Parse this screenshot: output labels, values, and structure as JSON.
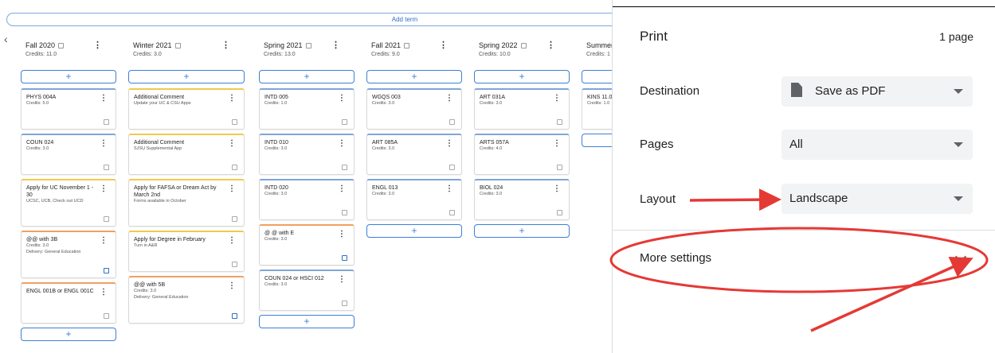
{
  "planner": {
    "add_term_label": "Add term",
    "add_label": "+",
    "terms": [
      {
        "name": "Fall 2020",
        "credits": "Credits: 11.0",
        "cards": [
          {
            "title": "PHYS 004A",
            "sub": [
              "Credits: 5.0"
            ],
            "accent": "blue",
            "note": "grey"
          },
          {
            "title": "COUN 024",
            "sub": [
              "Credits: 3.0"
            ],
            "accent": "blue",
            "note": "grey"
          },
          {
            "title": "Apply for UC November 1 - 30",
            "sub": [
              "UCSC, UCB, Check out UCD"
            ],
            "accent": "yellow",
            "note": "grey"
          },
          {
            "title": "@@ with 3B",
            "sub": [
              "Credits: 3.0",
              "Delivery: General Education"
            ],
            "accent": "orange",
            "note": "blue"
          },
          {
            "title": "ENGL 001B or ENGL 001C",
            "sub": [],
            "accent": "orange",
            "note": "grey"
          }
        ]
      },
      {
        "name": "Winter 2021",
        "credits": "Credits: 3.0",
        "cards": [
          {
            "title": "Additional Comment",
            "sub": [
              "Update your UC & CSU Apps"
            ],
            "accent": "yellow",
            "note": "grey"
          },
          {
            "title": "Additional Comment",
            "sub": [
              "SJSU Supplemental App"
            ],
            "accent": "yellow",
            "note": "grey"
          },
          {
            "title": "Apply for FAFSA or Dream Act by March 2nd",
            "sub": [
              "Forms available in October"
            ],
            "accent": "yellow",
            "note": "grey"
          },
          {
            "title": "Apply for Degree in February",
            "sub": [
              "Turn in A&R"
            ],
            "accent": "yellow",
            "note": "grey"
          },
          {
            "title": "@@ with 5B",
            "sub": [
              "Credits: 3.0",
              "Delivery: General Education"
            ],
            "accent": "orange",
            "note": "blue"
          }
        ]
      },
      {
        "name": "Spring 2021",
        "credits": "Credits: 13.0",
        "cards": [
          {
            "title": "INTD 005",
            "sub": [
              "Credits: 1.0"
            ],
            "accent": "blue",
            "note": "grey"
          },
          {
            "title": "INTD 010",
            "sub": [
              "Credits: 3.0"
            ],
            "accent": "blue",
            "note": "grey"
          },
          {
            "title": "INTD 020",
            "sub": [
              "Credits: 3.0"
            ],
            "accent": "blue",
            "note": "grey"
          },
          {
            "title": "@ @ with E",
            "sub": [
              "Credits: 3.0"
            ],
            "accent": "orange",
            "note": "blue"
          },
          {
            "title": "COUN 024 or HSCI 012",
            "sub": [
              "Credits: 3.0"
            ],
            "accent": "blue",
            "note": "grey"
          }
        ]
      },
      {
        "name": "Fall 2021",
        "credits": "Credits: 9.0",
        "cards": [
          {
            "title": "WGQS 003",
            "sub": [
              "Credits: 3.0"
            ],
            "accent": "blue",
            "note": "grey"
          },
          {
            "title": "ART 085A",
            "sub": [
              "Credits: 3.0"
            ],
            "accent": "blue",
            "note": "grey"
          },
          {
            "title": "ENGL 013",
            "sub": [
              "Credits: 3.0"
            ],
            "accent": "blue",
            "note": "grey"
          }
        ]
      },
      {
        "name": "Spring 2022",
        "credits": "Credits: 10.0",
        "cards": [
          {
            "title": "ART 031A",
            "sub": [
              "Credits: 3.0"
            ],
            "accent": "blue",
            "note": "grey"
          },
          {
            "title": "ARTS 057A",
            "sub": [
              "Credits: 4.0"
            ],
            "accent": "blue",
            "note": "grey"
          },
          {
            "title": "BIOL 024",
            "sub": [
              "Credits: 3.0"
            ],
            "accent": "blue",
            "note": "grey"
          }
        ]
      },
      {
        "name": "Summer",
        "credits": "Credits: 1",
        "cards": [
          {
            "title": "KINS 11.0",
            "sub": [
              "Credits: 1.0"
            ],
            "accent": "blue",
            "note": "grey"
          }
        ]
      }
    ]
  },
  "print": {
    "title": "Print",
    "page_count": "1 page",
    "destination_label": "Destination",
    "destination_value": "Save as PDF",
    "pages_label": "Pages",
    "pages_value": "All",
    "layout_label": "Layout",
    "layout_value": "Landscape",
    "more_settings_label": "More settings"
  },
  "colors": {
    "accent_blue": "#3d7fd6",
    "card_yellow": "#f2c94c",
    "card_orange": "#f0a060",
    "annotation_red": "#e53935"
  },
  "icons": {
    "note": "sticky-note-icon",
    "menu": "kebab-menu-icon",
    "back": "chevron-left-icon",
    "pdf": "document-icon",
    "expand": "chevron-down-icon"
  }
}
